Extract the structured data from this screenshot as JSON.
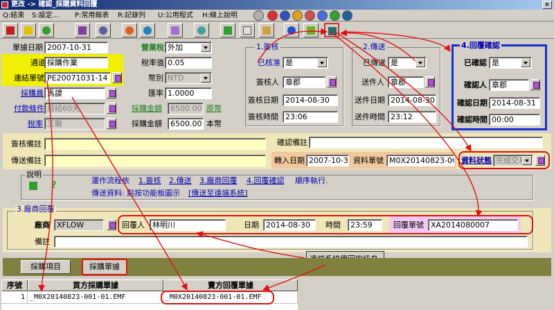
{
  "window": {
    "title": "更改 -> 確認_採購資料回覆"
  },
  "menu": [
    "Q:結束",
    "S:設定...",
    "P:常用報表",
    "R:記錄列",
    "U:公用程式",
    "H:線上說明"
  ],
  "form": {
    "doc_date_label": "單據日期",
    "doc_date": "2007-10-31",
    "channel_label": "通道",
    "channel": "採購作業",
    "link_no_label": "連結單號",
    "link_no": "PE20071031-14",
    "buyer_label": "採購員",
    "buyer": "馬謖",
    "pay_terms_label": "付款條件",
    "pay_terms": "月結60天",
    "tax_rate_label": "稅率",
    "tax_rate": "三聯",
    "tax_type_label": "營業稅",
    "tax_type": "外加",
    "tax_value_label": "稅率值",
    "tax_value": "0.05",
    "currency_label": "幣別",
    "currency": "NTD",
    "exch_label": "匯率",
    "exch": "1.0000",
    "amount_label": "採購金額",
    "amount": "6500.00",
    "amount_unit": "原幣",
    "amount2_label": "採購金額",
    "amount2": "6500.00",
    "amount2_unit": "本幣"
  },
  "approve": {
    "title": "1.簽核",
    "status_label": "已核准",
    "status": "是",
    "signer_label": "簽核人",
    "signer": "章郡",
    "date_label": "簽核日期",
    "date": "2014-08-30",
    "time_label": "簽核時間",
    "time": "23:06"
  },
  "deliver": {
    "title": "2.傳送",
    "status_label": "已傳送",
    "status": "是",
    "sender_label": "送件人",
    "sender": "章郡",
    "date_label": "送件日期",
    "date": "2014-08-30",
    "time_label": "送件時間",
    "time": "23:12"
  },
  "reply_confirm": {
    "title": "4.回覆確認",
    "status_label": "已確認",
    "status": "是",
    "person_label": "確認人",
    "person": "章郡",
    "date_label": "確認日期",
    "date": "2014-08-31",
    "time_label": "確認時間",
    "time": "00:00"
  },
  "remarks": {
    "sign_note_label": "簽核備註",
    "confirm_note_label": "確認備註",
    "send_note_label": "傳送備註",
    "transfer_date_label": "轉入日期",
    "transfer_date": "2007-10-31",
    "data_no_label": "資料單號",
    "data_no": "M0X20140823-001",
    "data_status_label": "資料狀態",
    "data_status": "完成交易"
  },
  "help": {
    "title": "說明",
    "line1_prefix": "運作流程依",
    "step1": "1.簽核",
    "step2": "2.傳送",
    "step3": "3.廠商回覆",
    "step4": "4.回覆確認",
    "line1_suffix": "順序執行.",
    "line2_prefix": "傳送資料: 點按功能板圖示",
    "link": "[傳送至遠端系統]"
  },
  "vendor": {
    "title": "3.廠商回覆",
    "vendor_label": "廠商",
    "vendor": "XFLOW",
    "replier_label": "回覆人",
    "replier": "林明川",
    "date_label": "日期",
    "date": "2014-08-30",
    "time_label": "時間",
    "time": "23:59",
    "reply_no_label": "回覆單號",
    "reply_no": "XA2014080007",
    "note_label": "備註"
  },
  "callout": "遠端系統傳回的訊息.",
  "tabs": {
    "items_label": "採購項目",
    "docs_label": "採購單據"
  },
  "table": {
    "headers": [
      "序號",
      "買方採購單據",
      "賣方回覆單據"
    ],
    "rows": [
      {
        "seq": "1",
        "buyer_doc": "_M0X20140823-001-01.EMF",
        "seller_doc": "_M0X20140823-001-01.EMF"
      }
    ]
  }
}
